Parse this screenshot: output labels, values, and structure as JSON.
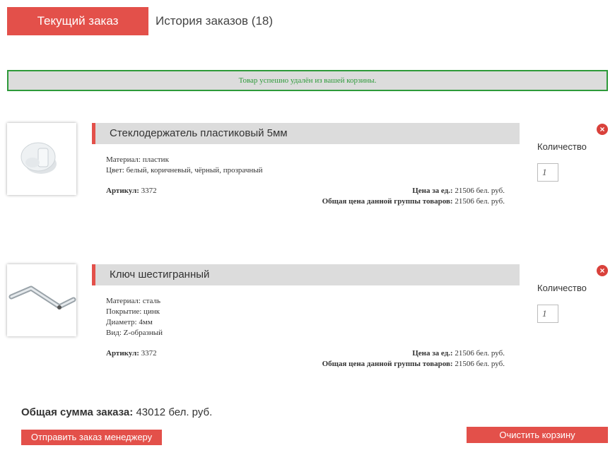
{
  "tabs": {
    "current": "Текущий заказ",
    "history": "История заказов (18)"
  },
  "notice": "Товар успешно удалён из вашей корзины.",
  "items": [
    {
      "title": "Стеклодержатель пластиковый 5мм",
      "attrs": [
        "Материал: пластик",
        "Цвет: белый, коричневый, чёрный, прозрачный"
      ],
      "sku_label": "Артикул:",
      "sku": "3372",
      "unit_price_label": "Цена за ед.:",
      "unit_price": "21506 бел. руб.",
      "group_price_label": "Общая цена данной группы товаров:",
      "group_price": "21506 бел. руб.",
      "qty_label": "Количество",
      "qty": "1"
    },
    {
      "title": "Ключ шестигранный",
      "attrs": [
        "Материал: сталь",
        "Покрытие: цинк",
        "Диаметр: 4мм",
        "Вид: Z-образный"
      ],
      "sku_label": "Артикул:",
      "sku": "3372",
      "unit_price_label": "Цена за ед.:",
      "unit_price": "21506 бел. руб.",
      "group_price_label": "Общая цена данной группы товаров:",
      "group_price": "21506 бел. руб.",
      "qty_label": "Количество",
      "qty": "1"
    }
  ],
  "total": {
    "label": "Общая сумма заказа:",
    "value": "43012 бел. руб."
  },
  "buttons": {
    "send": "Отправить заказ менеджеру",
    "clear": "Очистить корзину"
  },
  "colors": {
    "accent": "#e3504a",
    "success": "#2e9a3a",
    "bar": "#dcdcdc"
  }
}
